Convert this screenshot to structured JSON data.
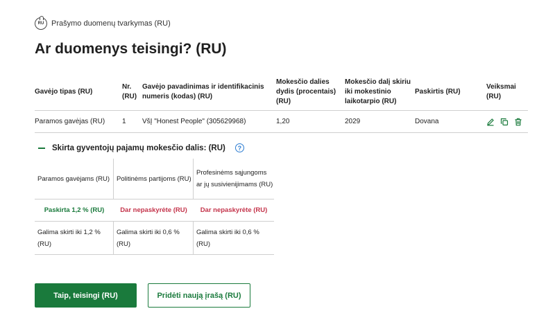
{
  "breadcrumb": {
    "logo_text": "RU",
    "label": "Prašymo duomenų tvarkymas (RU)"
  },
  "page_title": "Ar duomenys teisingi? (RU)",
  "main_table": {
    "headers": [
      "Gavėjo tipas (RU)",
      "Nr. (RU)",
      "Gavėjo pavadinimas ir identifikacinis numeris (kodas) (RU)",
      "Mokesčio dalies dydis (procentais) (RU)",
      "Mokesčio dalį skiriu iki mokestinio laikotarpio (RU)",
      "Paskirtis (RU)",
      "Veiksmai (RU)"
    ],
    "rows": [
      {
        "recipient_type": "Paramos gavėjas (RU)",
        "number": "1",
        "recipient_name": "VšĮ \"Honest People\" (305629968)",
        "percent": "1,20",
        "until_period": "2029",
        "purpose": "Dovana"
      }
    ]
  },
  "allocation_section": {
    "title": "Skirta gyventojų pajamų mokesčio dalis: (RU)",
    "help": "?",
    "columns": [
      {
        "header": "Paramos gavėjams (RU)",
        "status": "Paskirta 1,2 % (RU)",
        "status_color": "#1a7a3c",
        "allowance": "Galima skirti iki 1,2 % (RU)"
      },
      {
        "header": "Politinėms partijoms (RU)",
        "status": "Dar nepaskyrėte (RU)",
        "status_color": "#c4334a",
        "allowance": "Galima skirti iki 0,6 % (RU)"
      },
      {
        "header": "Profesinėms sąjungoms ar jų susivienijimams (RU)",
        "status": "Dar nepaskyrėte (RU)",
        "status_color": "#c4334a",
        "allowance": "Galima skirti iki 0,6 % (RU)"
      }
    ]
  },
  "buttons": {
    "confirm": "Taip, teisingi (RU)",
    "add_new": "Pridėti naują įrašą (RU)"
  },
  "colors": {
    "primary": "#1a7a3c",
    "danger": "#c4334a",
    "help": "#2a7bd1"
  }
}
